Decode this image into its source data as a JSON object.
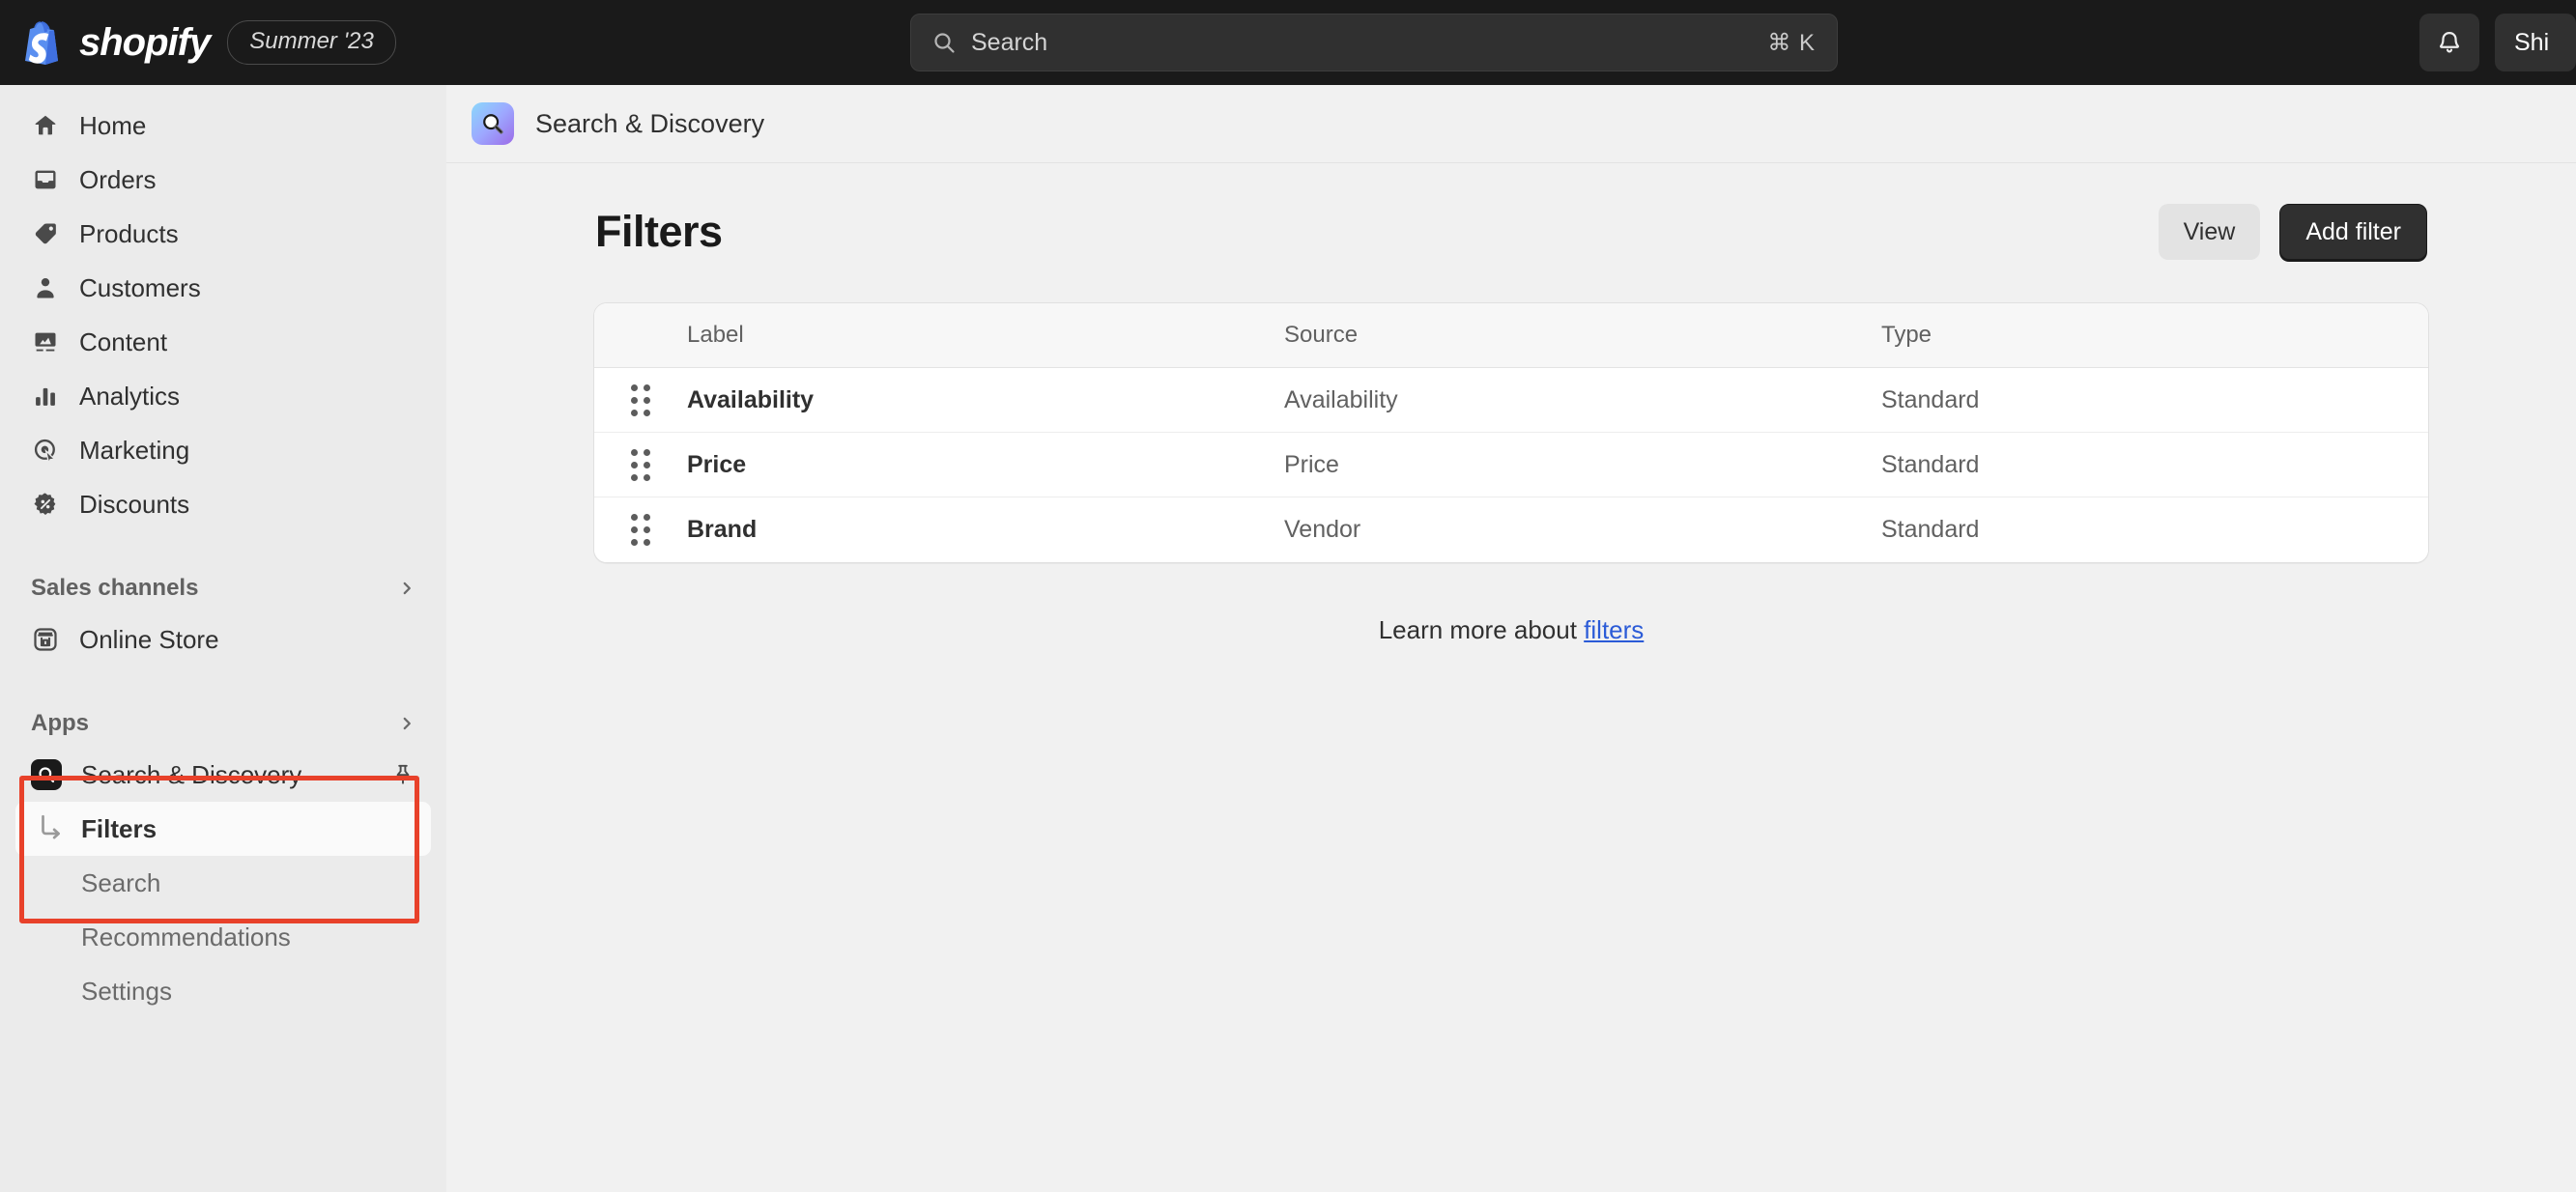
{
  "topbar": {
    "brand_name": "shopify",
    "season_badge": "Summer '23",
    "logo_icon": "shopify-bag-icon",
    "search": {
      "placeholder": "Search",
      "shortcut": "⌘ K",
      "icon": "search-icon"
    },
    "notifications_icon": "bell-icon",
    "store_chip": "Shi"
  },
  "sidebar": {
    "primary_items": [
      {
        "label": "Home",
        "icon": "home-icon"
      },
      {
        "label": "Orders",
        "icon": "orders-inbox-icon"
      },
      {
        "label": "Products",
        "icon": "product-tag-icon"
      },
      {
        "label": "Customers",
        "icon": "customer-person-icon"
      },
      {
        "label": "Content",
        "icon": "content-image-icon"
      },
      {
        "label": "Analytics",
        "icon": "analytics-bars-icon"
      },
      {
        "label": "Marketing",
        "icon": "marketing-target-icon"
      },
      {
        "label": "Discounts",
        "icon": "discount-badge-icon"
      }
    ],
    "sales_channels": {
      "title": "Sales channels",
      "chevron_icon": "chevron-right-icon",
      "items": [
        {
          "label": "Online Store",
          "icon": "online-store-icon"
        }
      ]
    },
    "apps": {
      "title": "Apps",
      "chevron_icon": "chevron-right-icon",
      "app": {
        "label": "Search & Discovery",
        "icon": "search-discovery-app-icon",
        "pin_icon": "pin-icon"
      },
      "sub_items": [
        {
          "label": "Filters",
          "active": true,
          "icon": "arrow-turn-down-right-icon"
        },
        {
          "label": "Search",
          "active": false
        },
        {
          "label": "Recommendations",
          "active": false
        },
        {
          "label": "Settings",
          "active": false
        }
      ]
    }
  },
  "app_header": {
    "title": "Search & Discovery",
    "icon": "search-discovery-app-icon"
  },
  "page": {
    "title": "Filters",
    "actions": {
      "view_label": "View",
      "add_filter_label": "Add filter"
    },
    "table": {
      "columns": [
        "Label",
        "Source",
        "Type"
      ],
      "rows": [
        {
          "handle_icon": "drag-handle-icon",
          "label": "Availability",
          "source": "Availability",
          "type": "Standard"
        },
        {
          "handle_icon": "drag-handle-icon",
          "label": "Price",
          "source": "Price",
          "type": "Standard"
        },
        {
          "handle_icon": "drag-handle-icon",
          "label": "Brand",
          "source": "Vendor",
          "type": "Standard"
        }
      ]
    },
    "footer": {
      "text": "Learn more about ",
      "link_text": "filters"
    }
  },
  "annotation": {
    "highlight_color": "#E8412A"
  }
}
